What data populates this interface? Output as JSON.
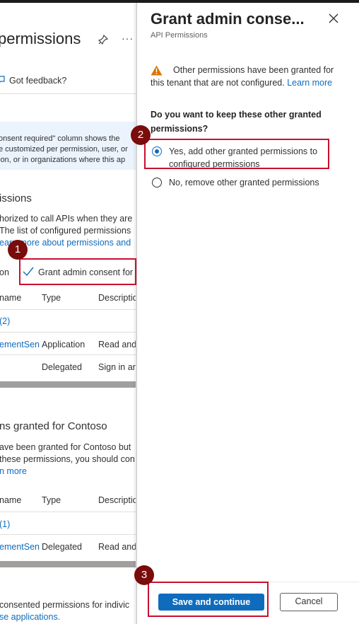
{
  "background": {
    "title": "permissions",
    "feedback": "Got feedback?",
    "info_lines": [
      "onsent required\" column shows the",
      "e customized per permission, user, or",
      "ion, or in organizations where this ap"
    ],
    "section1": {
      "heading": "issions",
      "lines": [
        "horized to call APIs when they are",
        " The list of configured permissions"
      ],
      "link": "earn more about permissions and",
      "toolbar_left": "on",
      "grant_label": "Grant admin consent for",
      "col_name": "name",
      "col_type": "Type",
      "col_desc": "Descriptio",
      "group": "(2)",
      "rows": [
        {
          "name": "ementSen",
          "type": "Application",
          "desc": "Read and"
        },
        {
          "name": "",
          "type": "Delegated",
          "desc": "Sign in ar"
        }
      ]
    },
    "section2": {
      "heading": "ns granted for Contoso",
      "lines": [
        "ave been granted for Contoso but",
        "these permissions, you should con"
      ],
      "link": "n more",
      "col_name": "name",
      "col_type": "Type",
      "col_desc": "Descriptio",
      "group": "(1)",
      "rows": [
        {
          "name": "ementSen",
          "type": "Delegated",
          "desc": "Read and"
        }
      ]
    },
    "bottom_line": " consented permissions for indivic",
    "bottom_link": "se applications."
  },
  "panel": {
    "title": "Grant admin conse...",
    "subtitle": "API Permissions",
    "warning_text": "Other permissions have been granted for this tenant that are not configured.",
    "learn_more": "Learn more",
    "question": "Do you want to keep these other granted permissions?",
    "options": [
      {
        "label": "Yes, add other granted permissions to configured permissions",
        "selected": true
      },
      {
        "label": "No, remove other granted permissions",
        "selected": false
      }
    ],
    "save_label": "Save and continue",
    "cancel_label": "Cancel"
  },
  "callouts": [
    "1",
    "2",
    "3"
  ],
  "colors": {
    "accent": "#0f6cbd",
    "callout": "#c8102e",
    "badge": "#7a0c0c",
    "warning": "#d97706"
  },
  "icons": [
    "pin-icon",
    "more-icon",
    "feedback-icon",
    "checkmark-icon",
    "close-icon",
    "warning-icon"
  ]
}
